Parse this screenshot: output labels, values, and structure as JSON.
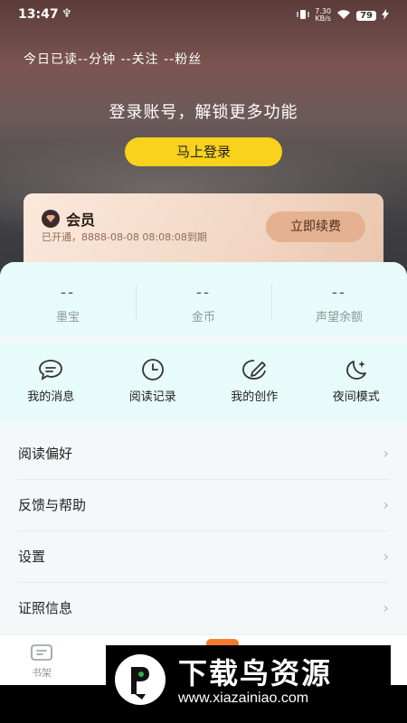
{
  "status": {
    "time": "13:47",
    "usb": "♆",
    "net_speed_top": "7.30",
    "net_speed_bottom": "KB/s",
    "battery": "79"
  },
  "header": {
    "stats": "今日已读--分钟 --关注 --粉丝",
    "login_prompt": "登录账号，解锁更多功能",
    "login_button": "马上登录"
  },
  "vip": {
    "title": "会员",
    "expiry": "已开通，8888-08-08 08:08:08到期",
    "renew_button": "立即续费"
  },
  "assets": [
    {
      "value": "--",
      "label": "墨宝"
    },
    {
      "value": "--",
      "label": "金币"
    },
    {
      "value": "--",
      "label": "声望余额"
    }
  ],
  "quick_actions": [
    {
      "label": "我的消息",
      "icon": "message-icon"
    },
    {
      "label": "阅读记录",
      "icon": "clock-icon"
    },
    {
      "label": "我的创作",
      "icon": "pen-icon"
    },
    {
      "label": "夜间模式",
      "icon": "moon-icon"
    }
  ],
  "menu": [
    {
      "label": "阅读偏好"
    },
    {
      "label": "反馈与帮助"
    },
    {
      "label": "设置"
    },
    {
      "label": "证照信息"
    }
  ],
  "tabbar": {
    "bookshelf_label": "书架"
  },
  "watermark": {
    "text": "下载鸟资源",
    "url": "www.xiazainiao.com"
  }
}
